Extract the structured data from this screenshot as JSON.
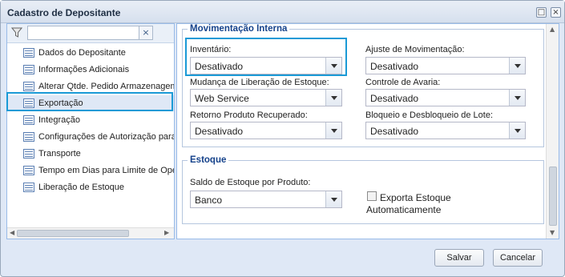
{
  "window": {
    "title": "Cadastro de Depositante"
  },
  "titlebar": {
    "restore_glyph": "□",
    "close_glyph": "×"
  },
  "filter": {
    "value": "",
    "clear_glyph": "×"
  },
  "nav": {
    "items": [
      {
        "label": "Dados do Depositante"
      },
      {
        "label": "Informações Adicionais"
      },
      {
        "label": "Alterar Qtde. Pedido Armazenagem"
      },
      {
        "label": "Exportação",
        "selected": true
      },
      {
        "label": "Integração"
      },
      {
        "label": "Configurações de Autorização para"
      },
      {
        "label": "Transporte"
      },
      {
        "label": "Tempo em Dias para Limite de Oper"
      },
      {
        "label": "Liberação de Estoque"
      }
    ]
  },
  "movimentacao": {
    "legend": "Movimentação Interna",
    "fields": [
      {
        "label": "Inventário:",
        "value": "Desativado"
      },
      {
        "label": "Ajuste de Movimentação:",
        "value": "Desativado"
      },
      {
        "label": "Mudança de Liberação de Estoque:",
        "value": "Web Service"
      },
      {
        "label": "Controle de Avaria:",
        "value": "Desativado"
      },
      {
        "label": "Retorno Produto Recuperado:",
        "value": "Desativado"
      },
      {
        "label": "Bloqueio e Desbloqueio de Lote:",
        "value": "Desativado"
      }
    ]
  },
  "estoque": {
    "legend": "Estoque",
    "saldo_label": "Saldo de Estoque por Produto:",
    "saldo_value": "Banco",
    "exporta_label_line1": "Exporta Estoque",
    "exporta_label_line2": "Automaticamente",
    "exporta_checked": false
  },
  "footer": {
    "save_label": "Salvar",
    "cancel_label": "Cancelar"
  },
  "colors": {
    "highlight": "#1a9ad6",
    "panel_bg": "#dfe8f6",
    "legend": "#15428b"
  }
}
